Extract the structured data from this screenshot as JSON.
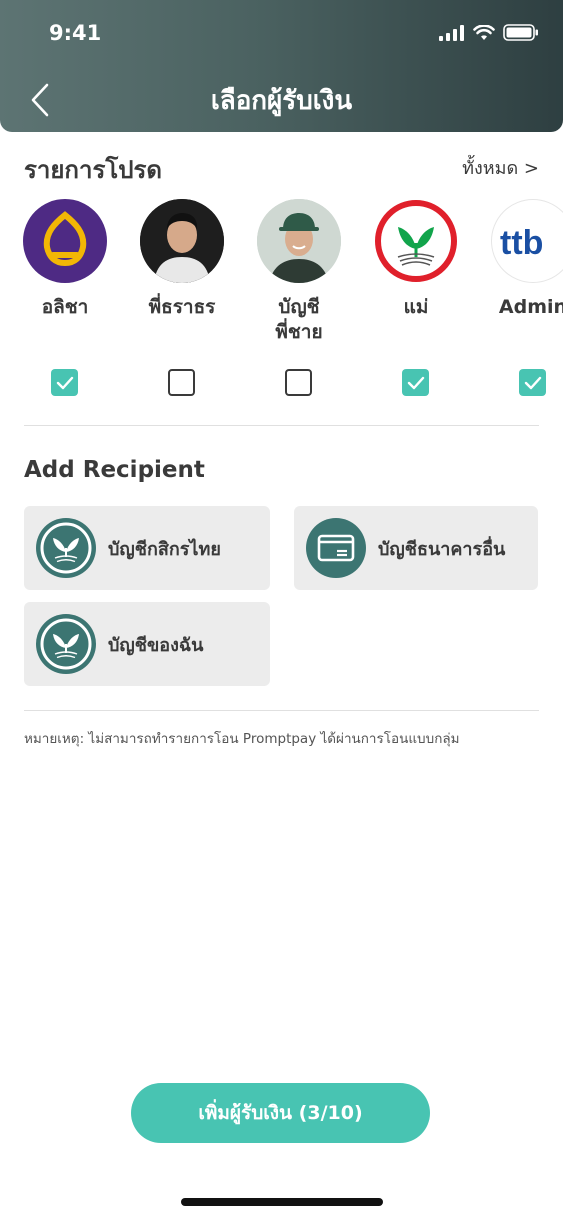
{
  "status_bar": {
    "time": "9:41"
  },
  "header": {
    "title": "เลือกผู้รับเงิน"
  },
  "favorites": {
    "title": "รายการโปรด",
    "see_all": "ทั้งหมด >",
    "items": [
      {
        "name": "อลิชา",
        "checked": true,
        "avatar": "scb-logo"
      },
      {
        "name": "พี่ธราธร",
        "checked": false,
        "avatar": "person-photo"
      },
      {
        "name": "บัญชี\nพี่ชาย",
        "checked": false,
        "avatar": "person-cap-photo"
      },
      {
        "name": "แม่",
        "checked": true,
        "avatar": "kbank-logo"
      },
      {
        "name": "Admin",
        "checked": true,
        "avatar": "ttb-logo",
        "logo_text": "ttb"
      }
    ]
  },
  "add_recipient": {
    "title": "Add Recipient",
    "options": [
      {
        "label": "บัญชีกสิกรไทย",
        "icon": "kbank-icon"
      },
      {
        "label": "บัญชีธนาคารอื่น",
        "icon": "card-icon"
      },
      {
        "label": "บัญชีของฉัน",
        "icon": "kbank-icon"
      }
    ]
  },
  "note": "หมายเหตุ: ไม่สามารถทำรายการโอน Promptpay ได้ผ่านการโอนแบบกลุ่ม",
  "primary_button": {
    "label": "เพิ่มผู้รับเงิน (3/10)"
  },
  "colors": {
    "accent": "#48c4b2",
    "header_dark": "#2e3f41",
    "icon_bg": "#3c7572",
    "tile_bg": "#ececec"
  }
}
